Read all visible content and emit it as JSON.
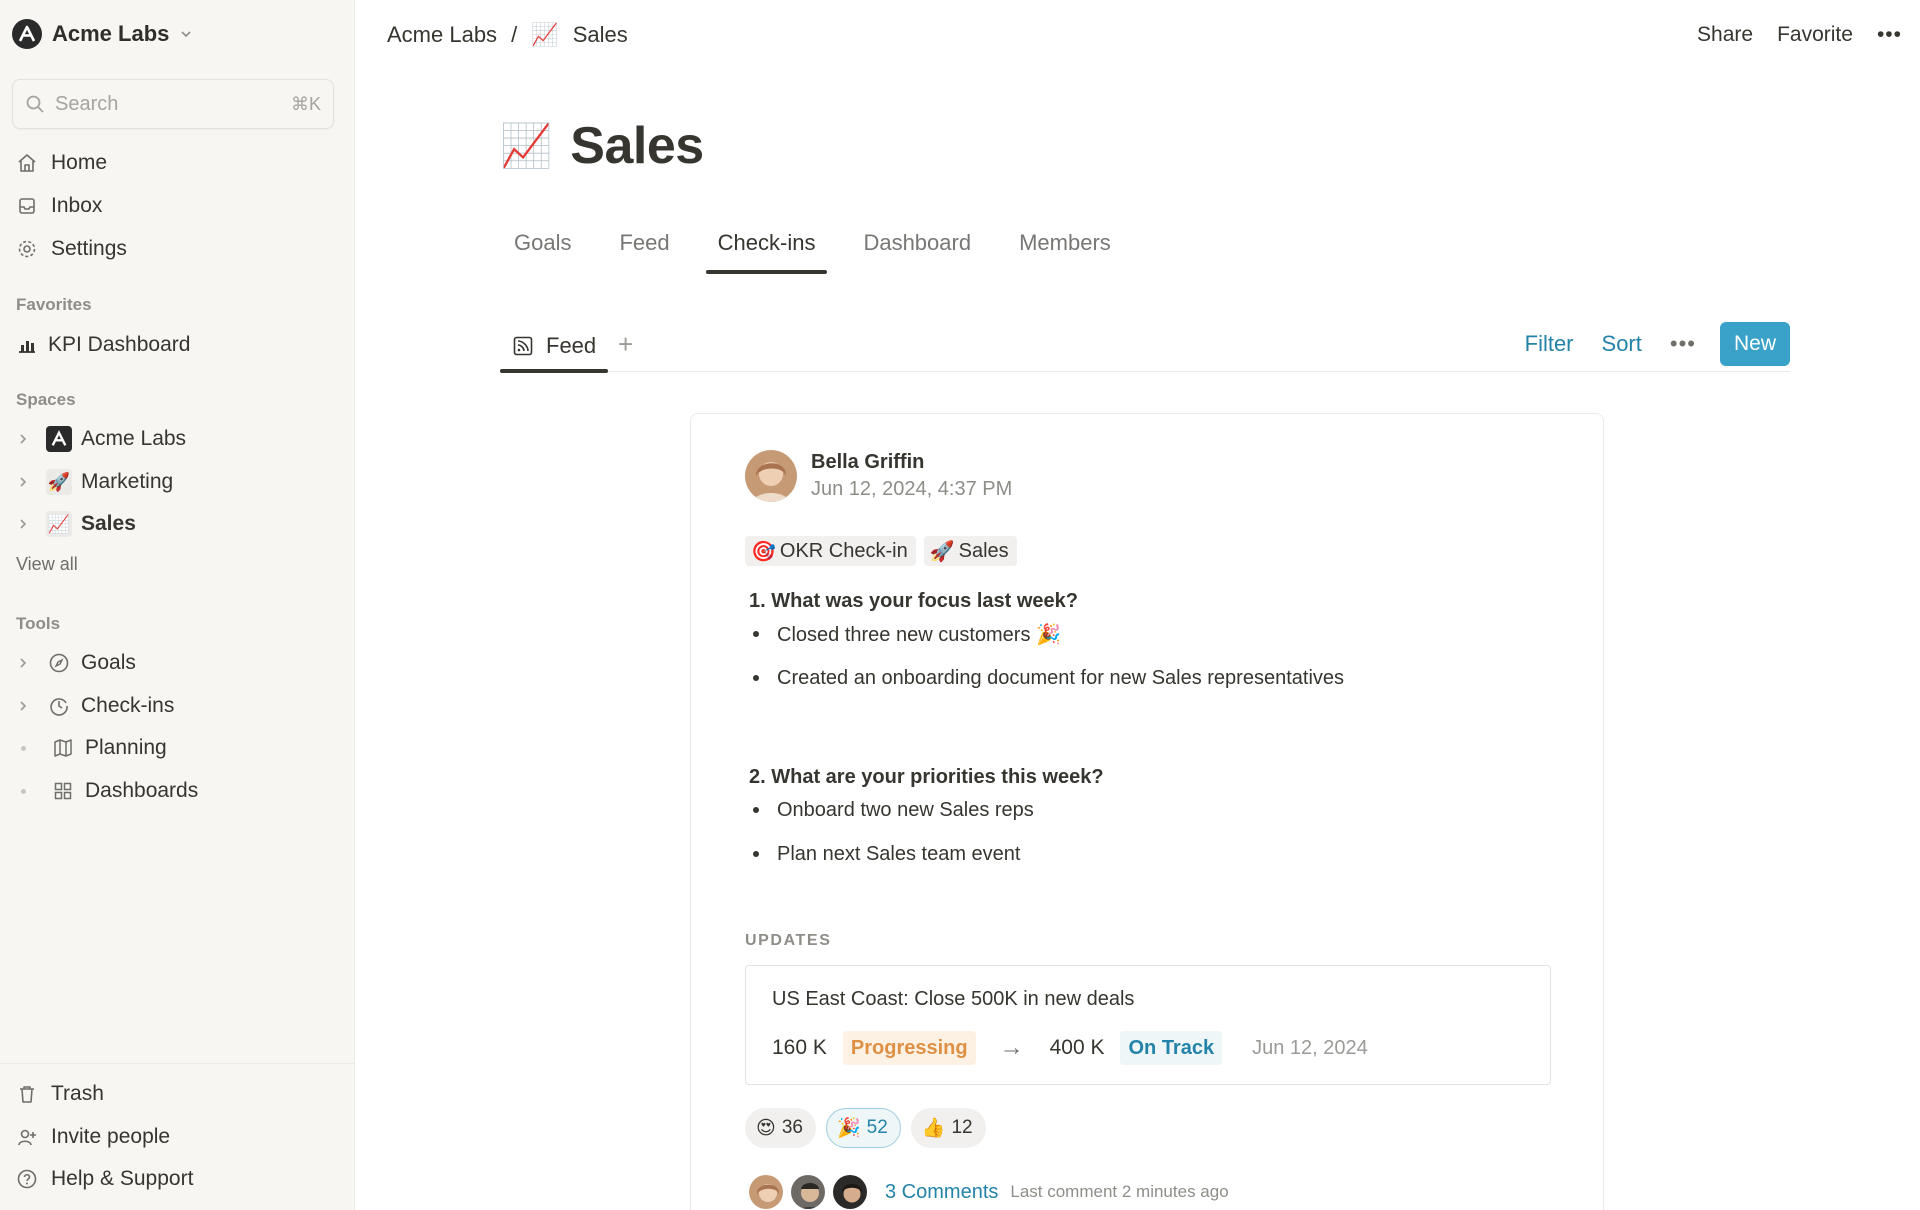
{
  "sidebar": {
    "workspace": "Acme Labs",
    "search_placeholder": "Search",
    "search_shortcut": "⌘K",
    "nav": [
      "Home",
      "Inbox",
      "Settings"
    ],
    "favorites_label": "Favorites",
    "favorites": [
      "KPI Dashboard"
    ],
    "spaces_label": "Spaces",
    "spaces": [
      "Acme Labs",
      "Marketing",
      "Sales"
    ],
    "view_all": "View all",
    "tools_label": "Tools",
    "tools": [
      "Goals",
      "Check-ins",
      "Planning",
      "Dashboards"
    ],
    "bottom": [
      "Trash",
      "Invite people",
      "Help & Support"
    ]
  },
  "topbar": {
    "breadcrumb": [
      "Acme Labs",
      "Sales"
    ],
    "separator": "/",
    "actions": [
      "Share",
      "Favorite"
    ]
  },
  "page": {
    "title": "Sales",
    "tabs": [
      "Goals",
      "Feed",
      "Check-ins",
      "Dashboard",
      "Members"
    ],
    "active_tab": "Check-ins"
  },
  "viewbar": {
    "view_label": "Feed",
    "add": "+",
    "filter": "Filter",
    "sort": "Sort",
    "new": "New"
  },
  "post": {
    "author": "Bella Griffin",
    "date": "Jun 12, 2024, 4:37 PM",
    "tags": [
      "OKR Check-in",
      "Sales"
    ],
    "q1": "1. What was your focus last week?",
    "q1_items": [
      "Closed three new customers 🎉",
      "Created an onboarding document for new Sales representatives"
    ],
    "q2": "2. What are your priorities this week?",
    "q2_items": [
      "Onboard two new Sales reps",
      "Plan next Sales team event"
    ],
    "updates_label": "UPDATES",
    "update": {
      "title": "US East Coast: Close 500K in new deals",
      "from_value": "160 K",
      "from_status": "Progressing",
      "to_value": "400 K",
      "to_status": "On Track",
      "date": "Jun 12, 2024"
    },
    "reactions": [
      {
        "emoji": "😍",
        "count": "36",
        "selected": false
      },
      {
        "emoji": "🎉",
        "count": "52",
        "selected": true
      },
      {
        "emoji": "👍",
        "count": "12",
        "selected": false
      }
    ],
    "comments_link": "3 Comments",
    "comments_meta": "Last comment 2 minutes ago"
  },
  "colors": {
    "accent": "#3aa2c8",
    "link": "#2383a8",
    "progressing": "#de9044",
    "sidebar_bg": "#f7f6f3"
  }
}
